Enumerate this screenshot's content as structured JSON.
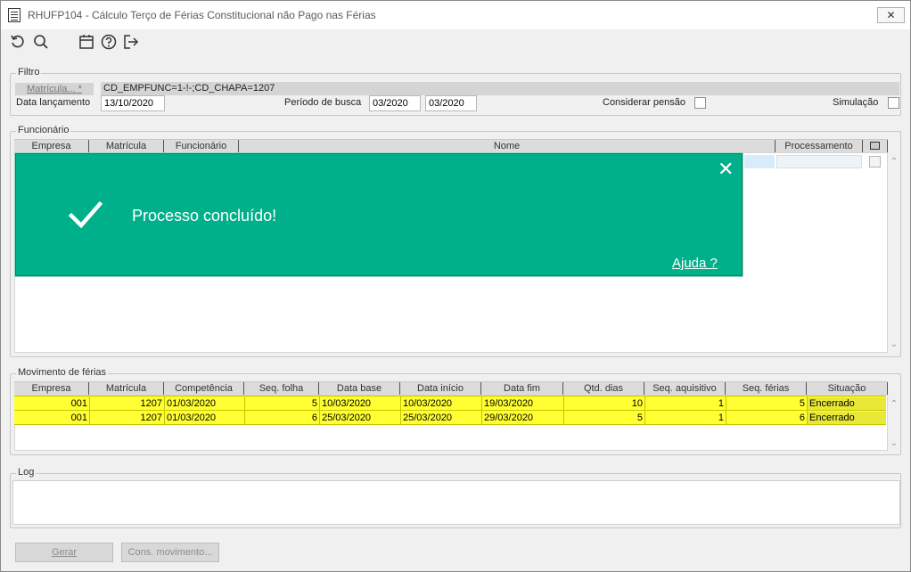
{
  "window": {
    "title": "RHUFP104 - Cálculo Terço de Férias Constitucional não Pago nas Férias",
    "close_label": "✕"
  },
  "toolbar": {
    "icons": [
      "refresh-icon",
      "search-icon",
      "calendar-icon",
      "help-icon",
      "exit-icon"
    ]
  },
  "filtro": {
    "title": "Filtro",
    "matricula_button": "Matrícula... *",
    "matricula_value": "CD_EMPFUNC=1-!-;CD_CHAPA=1207",
    "data_lancamento_label": "Data lançamento",
    "data_lancamento_value": "13/10/2020",
    "periodo_label": "Período de busca",
    "periodo_inicio": "03/2020",
    "periodo_fim": "03/2020",
    "considerar_pensao_label": "Considerar pensão",
    "considerar_pensao_checked": false,
    "simulacao_label": "Simulação",
    "simulacao_checked": false
  },
  "funcionario": {
    "title": "Funcionário",
    "columns": [
      "Empresa",
      "Matrícula",
      "Funcionário",
      "Nome",
      "Processamento"
    ]
  },
  "movimento": {
    "title": "Movimento de férias",
    "columns": [
      "Empresa",
      "Matrícula",
      "Competência",
      "Seq. folha",
      "Data base",
      "Data início",
      "Data fim",
      "Qtd. dias",
      "Seq. aquisitivo",
      "Seq. férias",
      "Situação"
    ],
    "rows": [
      [
        "001",
        "1207",
        "01/03/2020",
        "5",
        "10/03/2020",
        "10/03/2020",
        "19/03/2020",
        "10",
        "1",
        "5",
        "Encerrado"
      ],
      [
        "001",
        "1207",
        "01/03/2020",
        "6",
        "25/03/2020",
        "25/03/2020",
        "29/03/2020",
        "5",
        "1",
        "6",
        "Encerrado"
      ]
    ],
    "highlight_color": "#ffff33"
  },
  "log": {
    "title": "Log"
  },
  "buttons": {
    "gerar": "Gerar",
    "cons_movimento": "Cons. movimento..."
  },
  "toast": {
    "message": "Processo concluído!",
    "help_link": "Ajuda ?",
    "close_label": "✕",
    "background": "#00b08a"
  }
}
